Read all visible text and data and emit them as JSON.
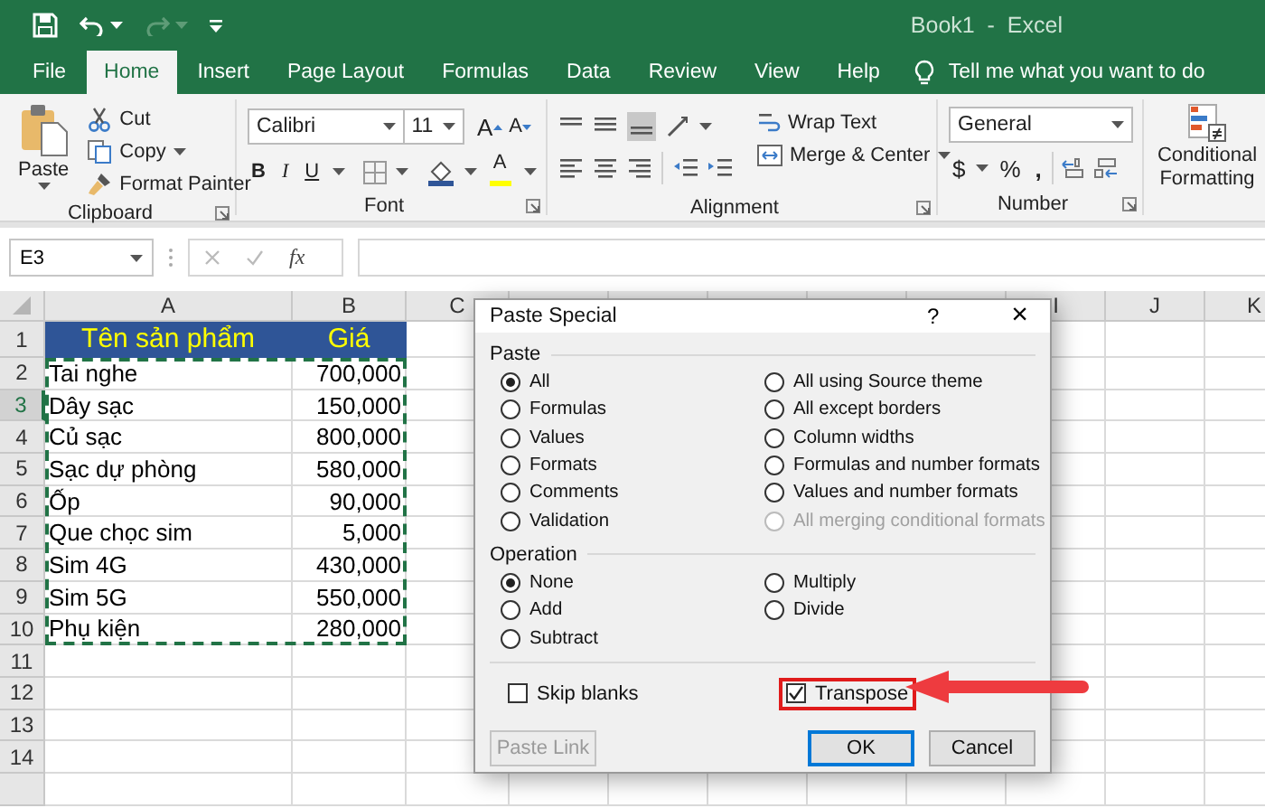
{
  "window": {
    "title": "Book1  -  Excel"
  },
  "tabs": [
    {
      "label": "File",
      "selected": false
    },
    {
      "label": "Home",
      "selected": true
    },
    {
      "label": "Insert",
      "selected": false
    },
    {
      "label": "Page Layout",
      "selected": false
    },
    {
      "label": "Formulas",
      "selected": false
    },
    {
      "label": "Data",
      "selected": false
    },
    {
      "label": "Review",
      "selected": false
    },
    {
      "label": "View",
      "selected": false
    },
    {
      "label": "Help",
      "selected": false
    }
  ],
  "tell_me": {
    "placeholder": "Tell me what you want to do"
  },
  "ribbon": {
    "clipboard": {
      "label": "Clipboard",
      "paste": "Paste",
      "cut": "Cut",
      "copy": "Copy",
      "format_painter": "Format Painter"
    },
    "font": {
      "label": "Font",
      "font_name": "Calibri",
      "font_size": "11",
      "grow": "A",
      "shrink": "A",
      "bold": "B",
      "italic": "I",
      "underline": "U",
      "font_color": "A"
    },
    "alignment": {
      "label": "Alignment",
      "wrap_text": "Wrap Text",
      "merge": "Merge & Center"
    },
    "number": {
      "label": "Number",
      "format": "General",
      "currency": "$",
      "percent": "%",
      "comma": ","
    },
    "styles": {
      "conditional_formatting": "Conditional Formatting"
    }
  },
  "formula_bar": {
    "name_box": "E3",
    "fx": "fx"
  },
  "sheet": {
    "columns": [
      "A",
      "B",
      "C",
      "I",
      "J",
      "K"
    ],
    "marquee": true,
    "rows": [
      {
        "number": "1",
        "kind": "header",
        "active": false,
        "cells": [
          "Tên sản phẩm",
          "Giá"
        ]
      },
      {
        "number": "2",
        "kind": "data",
        "active": false,
        "cells": [
          "Tai nghe",
          "700,000"
        ]
      },
      {
        "number": "3",
        "kind": "data",
        "active": true,
        "cells": [
          "Dây sạc",
          "150,000"
        ]
      },
      {
        "number": "4",
        "kind": "data",
        "active": false,
        "cells": [
          "Củ sạc",
          "800,000"
        ]
      },
      {
        "number": "5",
        "kind": "data",
        "active": false,
        "cells": [
          "Sạc dự phòng",
          "580,000"
        ]
      },
      {
        "number": "6",
        "kind": "data",
        "active": false,
        "cells": [
          "Ốp",
          "90,000"
        ]
      },
      {
        "number": "7",
        "kind": "data",
        "active": false,
        "cells": [
          "Que chọc sim",
          "5,000"
        ]
      },
      {
        "number": "8",
        "kind": "data",
        "active": false,
        "cells": [
          "Sim 4G",
          "430,000"
        ]
      },
      {
        "number": "9",
        "kind": "data",
        "active": false,
        "cells": [
          "Sim 5G",
          "550,000"
        ]
      },
      {
        "number": "10",
        "kind": "data",
        "active": false,
        "cells": [
          "Phụ kiện",
          "280,000"
        ]
      },
      {
        "number": "11",
        "kind": "empty",
        "active": false,
        "cells": []
      },
      {
        "number": "12",
        "kind": "empty",
        "active": false,
        "cells": []
      },
      {
        "number": "13",
        "kind": "empty",
        "active": false,
        "cells": []
      },
      {
        "number": "14",
        "kind": "empty",
        "active": false,
        "cells": []
      }
    ]
  },
  "dialog": {
    "title": "Paste Special",
    "help": "?",
    "close": "×",
    "paste": {
      "label": "Paste",
      "options": [
        {
          "label": "All",
          "selected": true,
          "disabled": false
        },
        {
          "label": "Formulas",
          "selected": false,
          "disabled": false
        },
        {
          "label": "Values",
          "selected": false,
          "disabled": false
        },
        {
          "label": "Formats",
          "selected": false,
          "disabled": false
        },
        {
          "label": "Comments",
          "selected": false,
          "disabled": false
        },
        {
          "label": "Validation",
          "selected": false,
          "disabled": false
        },
        {
          "label": "All using Source theme",
          "selected": false,
          "disabled": false
        },
        {
          "label": "All except borders",
          "selected": false,
          "disabled": false
        },
        {
          "label": "Column widths",
          "selected": false,
          "disabled": false
        },
        {
          "label": "Formulas and number formats",
          "selected": false,
          "disabled": false
        },
        {
          "label": "Values and number formats",
          "selected": false,
          "disabled": false
        },
        {
          "label": "All merging conditional formats",
          "selected": false,
          "disabled": true
        }
      ]
    },
    "operation": {
      "label": "Operation",
      "options": [
        {
          "label": "None",
          "selected": true,
          "disabled": false
        },
        {
          "label": "Add",
          "selected": false,
          "disabled": false
        },
        {
          "label": "Subtract",
          "selected": false,
          "disabled": false
        },
        {
          "label": "Multiply",
          "selected": false,
          "disabled": false
        },
        {
          "label": "Divide",
          "selected": false,
          "disabled": false
        }
      ]
    },
    "skip_blanks": {
      "label": "Skip blanks",
      "checked": false,
      "highlighted": false
    },
    "transpose": {
      "label": "Transpose",
      "checked": true,
      "highlighted": true
    },
    "buttons": [
      {
        "label": "Paste Link",
        "disabled": true,
        "default": false
      },
      {
        "label": "OK",
        "disabled": false,
        "default": true
      },
      {
        "label": "Cancel",
        "disabled": false,
        "default": false
      }
    ]
  }
}
